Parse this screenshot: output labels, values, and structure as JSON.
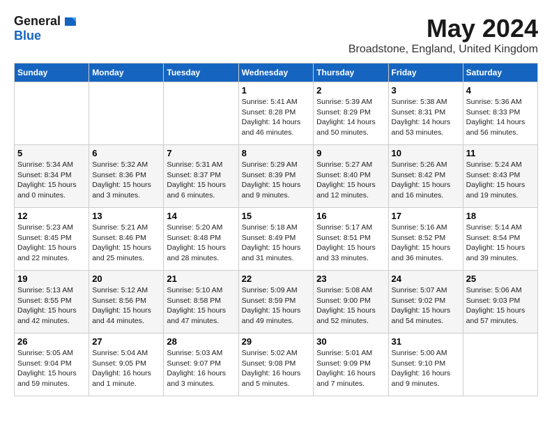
{
  "logo": {
    "general": "General",
    "blue": "Blue"
  },
  "title": "May 2024",
  "location": "Broadstone, England, United Kingdom",
  "days_header": [
    "Sunday",
    "Monday",
    "Tuesday",
    "Wednesday",
    "Thursday",
    "Friday",
    "Saturday"
  ],
  "weeks": [
    [
      {
        "day": "",
        "info": ""
      },
      {
        "day": "",
        "info": ""
      },
      {
        "day": "",
        "info": ""
      },
      {
        "day": "1",
        "info": "Sunrise: 5:41 AM\nSunset: 8:28 PM\nDaylight: 14 hours\nand 46 minutes."
      },
      {
        "day": "2",
        "info": "Sunrise: 5:39 AM\nSunset: 8:29 PM\nDaylight: 14 hours\nand 50 minutes."
      },
      {
        "day": "3",
        "info": "Sunrise: 5:38 AM\nSunset: 8:31 PM\nDaylight: 14 hours\nand 53 minutes."
      },
      {
        "day": "4",
        "info": "Sunrise: 5:36 AM\nSunset: 8:33 PM\nDaylight: 14 hours\nand 56 minutes."
      }
    ],
    [
      {
        "day": "5",
        "info": "Sunrise: 5:34 AM\nSunset: 8:34 PM\nDaylight: 15 hours\nand 0 minutes."
      },
      {
        "day": "6",
        "info": "Sunrise: 5:32 AM\nSunset: 8:36 PM\nDaylight: 15 hours\nand 3 minutes."
      },
      {
        "day": "7",
        "info": "Sunrise: 5:31 AM\nSunset: 8:37 PM\nDaylight: 15 hours\nand 6 minutes."
      },
      {
        "day": "8",
        "info": "Sunrise: 5:29 AM\nSunset: 8:39 PM\nDaylight: 15 hours\nand 9 minutes."
      },
      {
        "day": "9",
        "info": "Sunrise: 5:27 AM\nSunset: 8:40 PM\nDaylight: 15 hours\nand 12 minutes."
      },
      {
        "day": "10",
        "info": "Sunrise: 5:26 AM\nSunset: 8:42 PM\nDaylight: 15 hours\nand 16 minutes."
      },
      {
        "day": "11",
        "info": "Sunrise: 5:24 AM\nSunset: 8:43 PM\nDaylight: 15 hours\nand 19 minutes."
      }
    ],
    [
      {
        "day": "12",
        "info": "Sunrise: 5:23 AM\nSunset: 8:45 PM\nDaylight: 15 hours\nand 22 minutes."
      },
      {
        "day": "13",
        "info": "Sunrise: 5:21 AM\nSunset: 8:46 PM\nDaylight: 15 hours\nand 25 minutes."
      },
      {
        "day": "14",
        "info": "Sunrise: 5:20 AM\nSunset: 8:48 PM\nDaylight: 15 hours\nand 28 minutes."
      },
      {
        "day": "15",
        "info": "Sunrise: 5:18 AM\nSunset: 8:49 PM\nDaylight: 15 hours\nand 31 minutes."
      },
      {
        "day": "16",
        "info": "Sunrise: 5:17 AM\nSunset: 8:51 PM\nDaylight: 15 hours\nand 33 minutes."
      },
      {
        "day": "17",
        "info": "Sunrise: 5:16 AM\nSunset: 8:52 PM\nDaylight: 15 hours\nand 36 minutes."
      },
      {
        "day": "18",
        "info": "Sunrise: 5:14 AM\nSunset: 8:54 PM\nDaylight: 15 hours\nand 39 minutes."
      }
    ],
    [
      {
        "day": "19",
        "info": "Sunrise: 5:13 AM\nSunset: 8:55 PM\nDaylight: 15 hours\nand 42 minutes."
      },
      {
        "day": "20",
        "info": "Sunrise: 5:12 AM\nSunset: 8:56 PM\nDaylight: 15 hours\nand 44 minutes."
      },
      {
        "day": "21",
        "info": "Sunrise: 5:10 AM\nSunset: 8:58 PM\nDaylight: 15 hours\nand 47 minutes."
      },
      {
        "day": "22",
        "info": "Sunrise: 5:09 AM\nSunset: 8:59 PM\nDaylight: 15 hours\nand 49 minutes."
      },
      {
        "day": "23",
        "info": "Sunrise: 5:08 AM\nSunset: 9:00 PM\nDaylight: 15 hours\nand 52 minutes."
      },
      {
        "day": "24",
        "info": "Sunrise: 5:07 AM\nSunset: 9:02 PM\nDaylight: 15 hours\nand 54 minutes."
      },
      {
        "day": "25",
        "info": "Sunrise: 5:06 AM\nSunset: 9:03 PM\nDaylight: 15 hours\nand 57 minutes."
      }
    ],
    [
      {
        "day": "26",
        "info": "Sunrise: 5:05 AM\nSunset: 9:04 PM\nDaylight: 15 hours\nand 59 minutes."
      },
      {
        "day": "27",
        "info": "Sunrise: 5:04 AM\nSunset: 9:05 PM\nDaylight: 16 hours\nand 1 minute."
      },
      {
        "day": "28",
        "info": "Sunrise: 5:03 AM\nSunset: 9:07 PM\nDaylight: 16 hours\nand 3 minutes."
      },
      {
        "day": "29",
        "info": "Sunrise: 5:02 AM\nSunset: 9:08 PM\nDaylight: 16 hours\nand 5 minutes."
      },
      {
        "day": "30",
        "info": "Sunrise: 5:01 AM\nSunset: 9:09 PM\nDaylight: 16 hours\nand 7 minutes."
      },
      {
        "day": "31",
        "info": "Sunrise: 5:00 AM\nSunset: 9:10 PM\nDaylight: 16 hours\nand 9 minutes."
      },
      {
        "day": "",
        "info": ""
      }
    ]
  ]
}
